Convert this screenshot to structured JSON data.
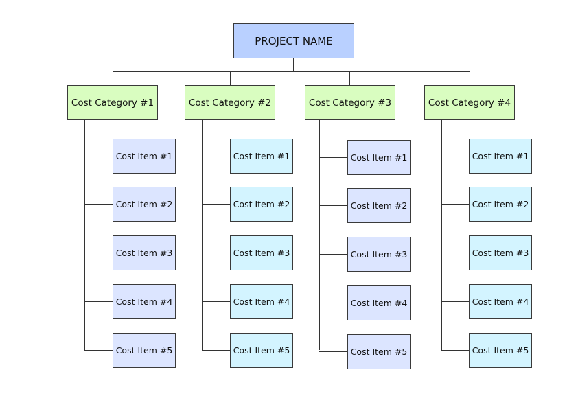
{
  "project": {
    "label": "PROJECT NAME",
    "color": "#b9d0ff"
  },
  "category_color": "#d9fdc0",
  "categories": [
    {
      "label": "Cost Category #1",
      "item_color": "#dce5ff",
      "items": [
        "Cost Item #1",
        "Cost Item #2",
        "Cost Item #3",
        "Cost Item #4",
        "Cost Item #5"
      ]
    },
    {
      "label": "Cost Category #2",
      "item_color": "#d3f4ff",
      "items": [
        "Cost Item #1",
        "Cost Item #2",
        "Cost Item #3",
        "Cost Item #4",
        "Cost Item #5"
      ]
    },
    {
      "label": "Cost Category #3",
      "item_color": "#dce5ff",
      "items": [
        "Cost Item #1",
        "Cost Item #2",
        "Cost Item #3",
        "Cost Item #4",
        "Cost Item #5"
      ]
    },
    {
      "label": "Cost Category #4",
      "item_color": "#d3f4ff",
      "items": [
        "Cost Item #1",
        "Cost Item #2",
        "Cost Item #3",
        "Cost Item #4",
        "Cost Item #5"
      ]
    }
  ]
}
